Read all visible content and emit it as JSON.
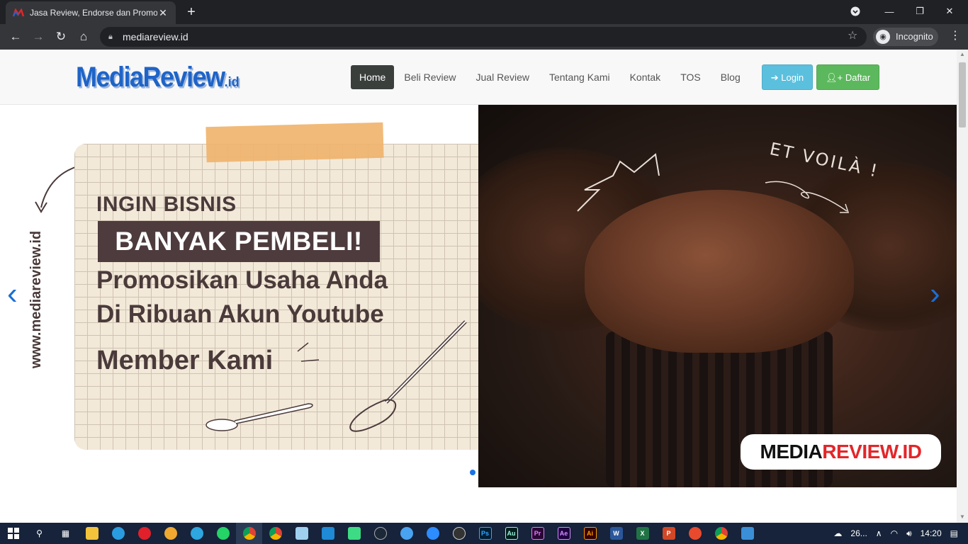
{
  "browser": {
    "tab_title": "Jasa Review, Endorse dan Promosi",
    "tab_close": "✕",
    "new_tab": "+",
    "url": "mediareview.id",
    "incognito_label": "Incognito",
    "window_controls": {
      "minimize": "—",
      "maximize": "❐",
      "close": "✕"
    }
  },
  "site": {
    "logo_main": "MediaReview",
    "logo_suffix": ".id",
    "nav": [
      {
        "label": "Home",
        "active": true
      },
      {
        "label": "Beli Review"
      },
      {
        "label": "Jual Review"
      },
      {
        "label": "Tentang Kami"
      },
      {
        "label": "Kontak"
      },
      {
        "label": "TOS"
      },
      {
        "label": "Blog"
      }
    ],
    "login_label": "Login",
    "daftar_label": "Daftar"
  },
  "hero": {
    "vertical_text": "www.mediareview.id",
    "line1": "INGIN BISNIS",
    "badge": "BANYAK PEMBELI!",
    "line3": "Promosikan Usaha Anda",
    "line4": "Di Ribuan Akun Youtube",
    "line5": "Member Kami",
    "et_voila": "ET VOILÀ !",
    "logo_black": "MEDIA",
    "logo_red": "REVIEW.ID",
    "prev_arrow": "‹",
    "next_arrow": "›"
  },
  "taskbar": {
    "temperature": "26...",
    "time": "14:20"
  },
  "colors": {
    "nav_active_bg": "#3a3f3c",
    "login_bg": "#5bc0de",
    "daftar_bg": "#5cb85c",
    "logo_blue": "#1e64c8",
    "badge_bg": "#4e3b3d",
    "carousel_accent": "#1a6fd6"
  }
}
